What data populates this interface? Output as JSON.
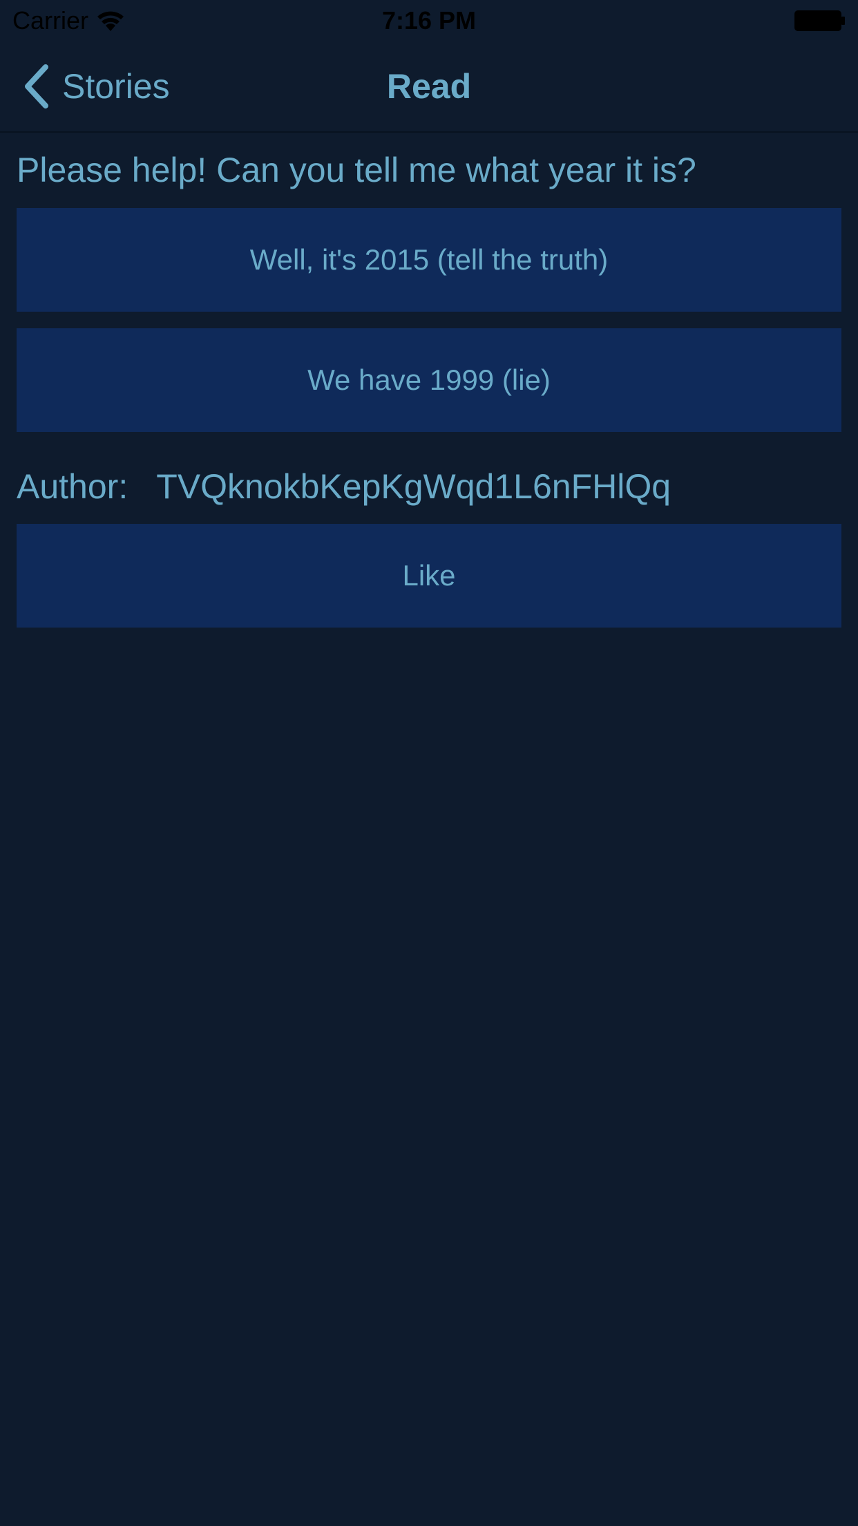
{
  "status_bar": {
    "carrier": "Carrier",
    "time": "7:16 PM",
    "wifi_icon": "wifi-icon",
    "battery_icon": "battery-icon"
  },
  "nav": {
    "back_label": "Stories",
    "back_icon": "chevron-left-icon",
    "title": "Read"
  },
  "story": {
    "question": "Please help! Can you tell me what year it is?",
    "choices": [
      {
        "label": "Well, it's 2015 (tell the truth)"
      },
      {
        "label": "We have 1999 (lie)"
      }
    ],
    "author_label": "Author:",
    "author_value": "TVQknokbKepKgWqd1L6nFHlQq",
    "like_label": "Like"
  },
  "colors": {
    "background": "#0e1b2d",
    "button": "#0f2a5a",
    "accent_text": "#6aabc9"
  }
}
